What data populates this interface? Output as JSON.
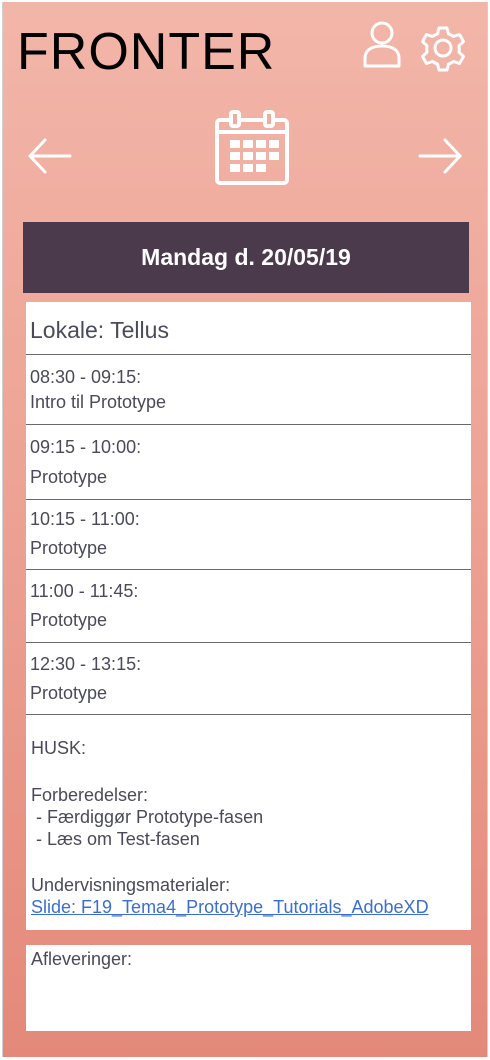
{
  "app": {
    "title": "FRONTER"
  },
  "icons": {
    "user": "user-icon",
    "settings": "gear-icon",
    "prev": "arrow-left-icon",
    "next": "arrow-right-icon",
    "calendar": "calendar-icon"
  },
  "day": {
    "header": "Mandag d. 20/05/19"
  },
  "schedule": {
    "room": "Lokale: Tellus",
    "slots": [
      {
        "time": "08:30 - 09:15:",
        "subject": "Intro til Prototype"
      },
      {
        "time": "09:15 - 10:00:",
        "subject": "Prototype"
      },
      {
        "time": "10:15 - 11:00:",
        "subject": "Prototype"
      },
      {
        "time": "11:00 - 11:45:",
        "subject": "Prototype"
      },
      {
        "time": "12:30 - 13:15:",
        "subject": "Prototype"
      }
    ],
    "notes": {
      "remember": "HUSK:",
      "prep_title": "Forberedelser:",
      "prep_items": [
        " - Færdiggør Prototype-fasen",
        " - Læs om Test-fasen"
      ],
      "materials_title": "Undervisningsmaterialer:",
      "materials_link": "Slide: F19_Tema4_Prototype_Tutorials_AdobeXD"
    }
  },
  "hand_in": {
    "label": "Afleveringer:"
  },
  "colors": {
    "header_bg": "#4b3a4b",
    "gradient_top": "#f2b6a9",
    "gradient_bottom": "#e4897a",
    "link": "#3a6fd1"
  }
}
